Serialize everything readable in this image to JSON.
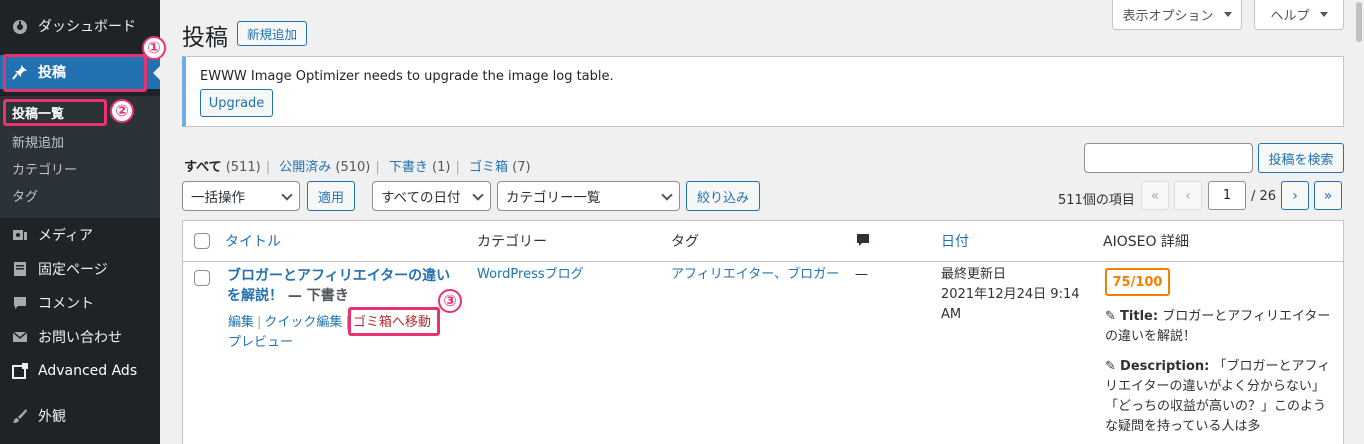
{
  "sidebar": {
    "dashboard": {
      "icon": "dashboard-icon",
      "label": "ダッシュボード"
    },
    "posts": {
      "icon": "pin-icon",
      "label": "投稿"
    },
    "posts_sub": [
      "投稿一覧",
      "新規追加",
      "カテゴリー",
      "タグ"
    ],
    "media": {
      "icon": "media-icon",
      "label": "メディア"
    },
    "pages": {
      "icon": "page-icon",
      "label": "固定ページ"
    },
    "comments": {
      "icon": "comment-icon",
      "label": "コメント"
    },
    "contact": {
      "icon": "mail-icon",
      "label": "お問い合わせ"
    },
    "ads": {
      "icon": "ads-icon",
      "label": "Advanced Ads"
    },
    "appearance": {
      "icon": "brush-icon",
      "label": "外観"
    }
  },
  "annotations": [
    "①",
    "②",
    "③"
  ],
  "header": {
    "screen_options": "表示オプション",
    "help": "ヘルプ",
    "title": "投稿",
    "add_new": "新規追加"
  },
  "notice": {
    "text": "EWWW Image Optimizer needs to upgrade the image log table.",
    "button": "Upgrade"
  },
  "filters": {
    "all": {
      "label": "すべて",
      "count": "(511)"
    },
    "published": {
      "label": "公開済み",
      "count": "(510)"
    },
    "drafts": {
      "label": "下書き",
      "count": "(1)"
    },
    "trash": {
      "label": "ゴミ箱",
      "count": "(7)"
    }
  },
  "search_button": "投稿を検索",
  "toolbar": {
    "bulk_action": "一括操作",
    "apply": "適用",
    "dates": "すべての日付",
    "categories": "カテゴリー一覧",
    "filter": "絞り込み"
  },
  "pagination": {
    "items": "511個の項目",
    "first": "«",
    "prev": "‹",
    "current": "1",
    "total": "/ 26",
    "next": "›",
    "last": "»"
  },
  "table": {
    "columns": {
      "title": "タイトル",
      "category": "カテゴリー",
      "tags": "タグ",
      "comments_icon": "comment-icon",
      "date": "日付",
      "aioseo": "AIOSEO 詳細"
    },
    "row": {
      "title_line1": "ブロガーとアフィリエイターの違い",
      "title_line2": "を解説！",
      "state": "— 下書き",
      "actions": {
        "edit": "編集",
        "quick_edit": "クイック編集",
        "trash": "ゴミ箱へ移動",
        "preview": "プレビュー"
      },
      "category": "WordPressブログ",
      "tags": "アフィリエイター、ブロガー",
      "comments": "—",
      "date_label": "最終更新日",
      "date_value_1": "2021年12月24日 9:14",
      "date_value_2": "AM",
      "score": "75/100",
      "aio_title_label": "Title:",
      "aio_title_1": "ブロガーとアフィリエイター",
      "aio_title_2": "の違いを解説！",
      "aio_desc_label": "Description:",
      "aio_desc_1": "「ブロガーとアフィ",
      "aio_desc_2": "リエイターの違いがよく分からない」",
      "aio_desc_3": "「どっちの収益が高いの？」このよう",
      "aio_desc_4": "な疑問を持っている人は多"
    }
  }
}
